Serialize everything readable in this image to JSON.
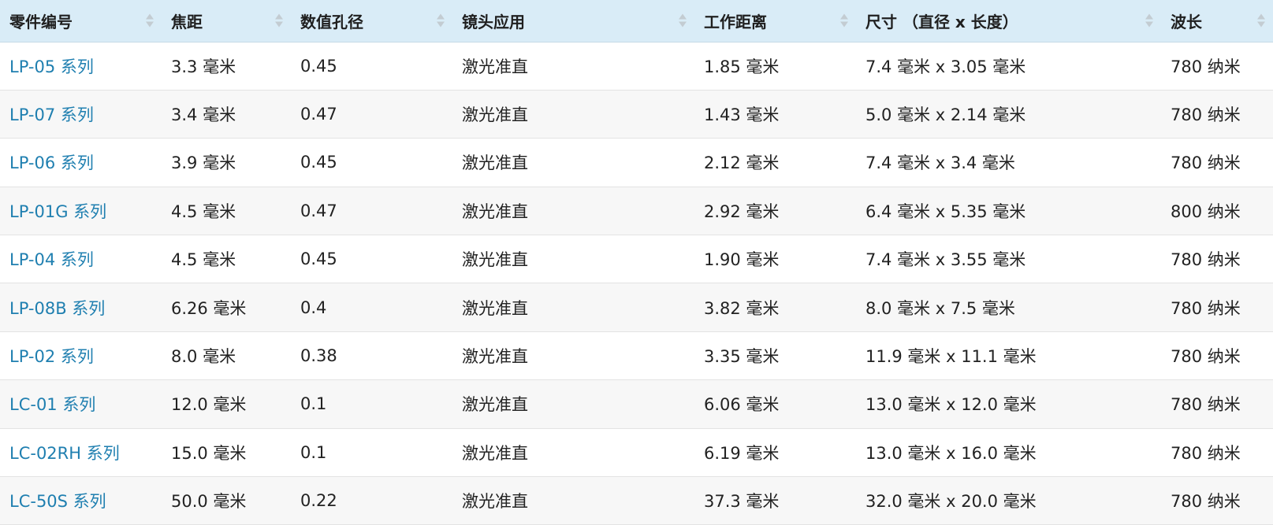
{
  "table": {
    "headers": [
      "零件编号",
      "焦距",
      "数值孔径",
      "镜头应用",
      "工作距离",
      "尺寸 （直径 x 长度）",
      "波长"
    ],
    "rows": [
      [
        "LP-05 系列",
        "3.3 毫米",
        "0.45",
        "激光准直",
        "1.85 毫米",
        "7.4 毫米 x 3.05 毫米",
        "780 纳米"
      ],
      [
        "LP-07 系列",
        "3.4 毫米",
        "0.47",
        "激光准直",
        "1.43 毫米",
        "5.0 毫米 x 2.14 毫米",
        "780 纳米"
      ],
      [
        "LP-06 系列",
        "3.9 毫米",
        "0.45",
        "激光准直",
        "2.12 毫米",
        "7.4 毫米 x 3.4 毫米",
        "780 纳米"
      ],
      [
        "LP-01G 系列",
        "4.5 毫米",
        "0.47",
        "激光准直",
        "2.92 毫米",
        "6.4 毫米 x 5.35 毫米",
        "800 纳米"
      ],
      [
        "LP-04 系列",
        "4.5 毫米",
        "0.45",
        "激光准直",
        "1.90 毫米",
        "7.4 毫米 x 3.55 毫米",
        "780 纳米"
      ],
      [
        "LP-08B 系列",
        "6.26 毫米",
        "0.4",
        "激光准直",
        "3.82 毫米",
        "8.0 毫米 x 7.5 毫米",
        "780 纳米"
      ],
      [
        "LP-02 系列",
        "8.0 毫米",
        "0.38",
        "激光准直",
        "3.35 毫米",
        "11.9 毫米 x 11.1 毫米",
        "780 纳米"
      ],
      [
        "LC-01 系列",
        "12.0 毫米",
        "0.1",
        "激光准直",
        "6.06 毫米",
        "13.0 毫米 x 12.0 毫米",
        "780 纳米"
      ],
      [
        "LC-02RH 系列",
        "15.0 毫米",
        "0.1",
        "激光准直",
        "6.19 毫米",
        "13.0 毫米 x 16.0 毫米",
        "780 纳米"
      ],
      [
        "LC-50S 系列",
        "50.0 毫米",
        "0.22",
        "激光准直",
        "37.3 毫米",
        "32.0 毫米 x 20.0 毫米",
        "780 纳米"
      ]
    ]
  },
  "icons": {
    "sort": "sort-both-icon"
  },
  "colors": {
    "header_bg": "#d9ecf7",
    "link": "#1f7fb0",
    "row_alt": "#f7f7f7"
  }
}
